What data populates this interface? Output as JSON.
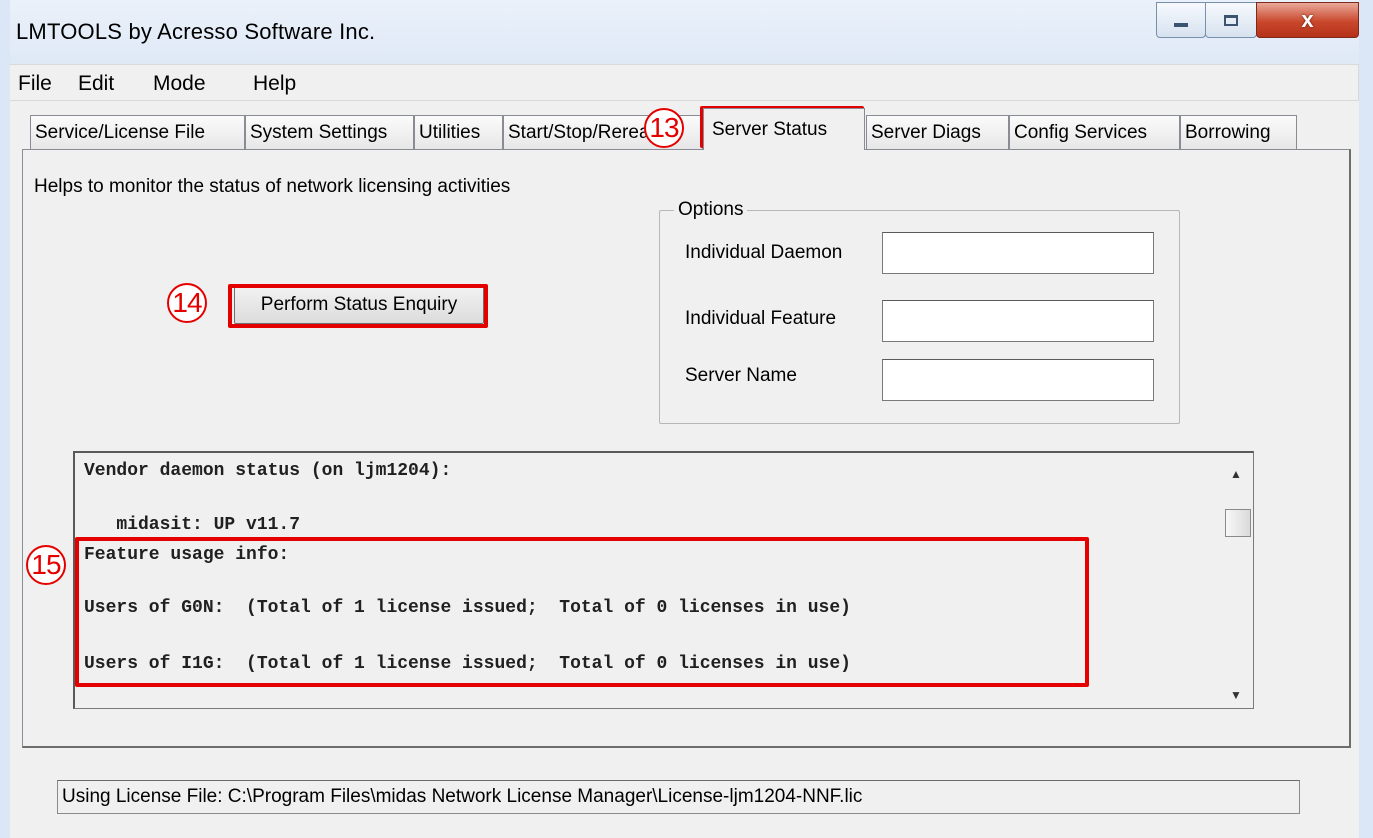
{
  "window": {
    "title": "LMTOOLS by Acresso Software Inc.",
    "controls": {
      "minimize": "minimize",
      "maximize": "maximize",
      "close": "x"
    }
  },
  "menu": [
    "File",
    "Edit",
    "Mode",
    "Help"
  ],
  "tabs": [
    {
      "label": "Service/License File"
    },
    {
      "label": "System Settings"
    },
    {
      "label": "Utilities"
    },
    {
      "label": "Start/Stop/Reread"
    },
    {
      "label": "Server Status",
      "active": true
    },
    {
      "label": "Server Diags"
    },
    {
      "label": "Config Services"
    },
    {
      "label": "Borrowing"
    }
  ],
  "server_status": {
    "description": "Helps to monitor the status of network licensing activities",
    "perform_button": "Perform Status Enquiry",
    "options": {
      "title": "Options",
      "individual_daemon_label": "Individual Daemon",
      "individual_daemon_value": "",
      "individual_feature_label": "Individual Feature",
      "individual_feature_value": "",
      "server_name_label": "Server Name",
      "server_name_value": ""
    },
    "output_lines": [
      "Vendor daemon status (on ljm1204):",
      "   midasit: UP v11.7",
      "Feature usage info:",
      "Users of G0N:  (Total of 1 license issued;  Total of 0 licenses in use)",
      "Users of I1G:  (Total of 1 license issued;  Total of 0 licenses in use)"
    ]
  },
  "status_bar": "Using License File:  C:\\Program Files\\midas Network License Manager\\License-ljm1204-NNF.lic",
  "annotations": {
    "callout_13": "13",
    "callout_14": "14",
    "callout_15": "15",
    "color": "#e50000"
  }
}
